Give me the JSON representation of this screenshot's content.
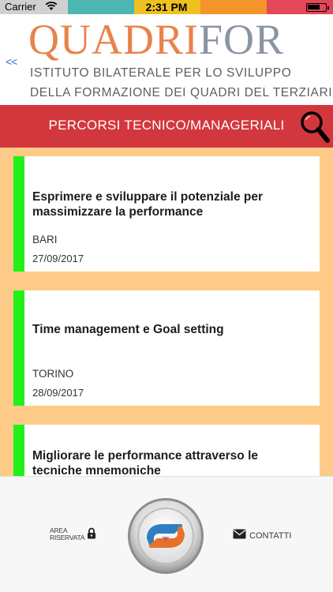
{
  "status_bar": {
    "carrier": "Carrier",
    "time": "2:31 PM",
    "colors": [
      "#cfd0d1",
      "#4db6b2",
      "#f0c020",
      "#f4942a",
      "#e2475a"
    ]
  },
  "header": {
    "back_label": "<<",
    "logo_part1": "QUADRI",
    "logo_part2": "FOR",
    "logo_subtitle_line1": "ISTITUTO BILATERALE PER LO SVILUPPO",
    "logo_subtitle_line2": "DELLA FORMAZIONE DEI QUADRI DEL TERZIARIO"
  },
  "title_bar": {
    "title": "PERCORSI TECNICO/MANAGERIALI",
    "search_icon": "magnifier-icon",
    "color": "#d3373e"
  },
  "courses": [
    {
      "title": "Esprimere e sviluppare il potenziale per massimizzare la performance",
      "city": "BARI",
      "date": "27/09/2017"
    },
    {
      "title": "Time management e Goal setting",
      "city": "TORINO",
      "date": "28/09/2017"
    },
    {
      "title": "Migliorare le performance attraverso le tecniche mnemoniche",
      "city": "",
      "date": ""
    }
  ],
  "bottom_bar": {
    "area_riservata_line1": "AREA",
    "area_riservata_line2": "RISERVATA",
    "contatti_label": "CONTATTI",
    "lock_icon": "lock-icon",
    "envelope_icon": "envelope-icon",
    "center_icon": "quadrifor-logo-icon"
  },
  "colors": {
    "list_background": "#fdcb87",
    "card_accent": "#22f018",
    "brand_orange": "#e8834a",
    "brand_gray": "#8a94a2"
  }
}
